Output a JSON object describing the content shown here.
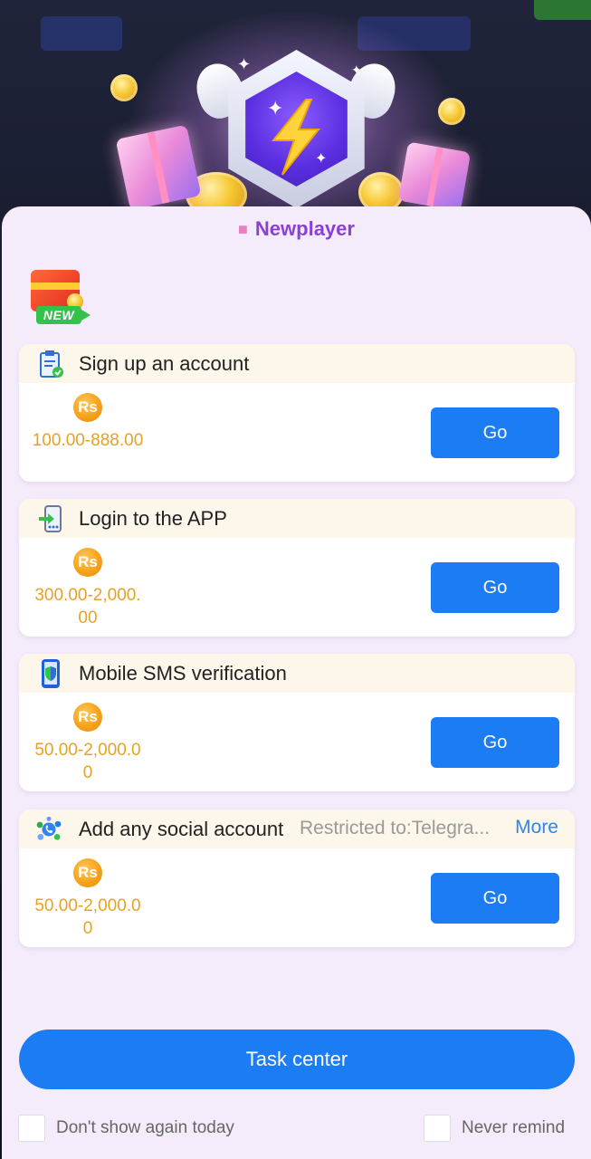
{
  "modal": {
    "title": "Newplayer",
    "new_badge_label": "NEW"
  },
  "tasks": [
    {
      "title": "Sign up an account",
      "icon": "clipboard-check-icon",
      "currency": "Rs",
      "reward": "100.00-888.00",
      "button": "Go"
    },
    {
      "title": "Login to the APP",
      "icon": "phone-login-icon",
      "currency": "Rs",
      "reward": "300.00-2,000.00",
      "button": "Go"
    },
    {
      "title": "Mobile SMS verification",
      "icon": "phone-shield-icon",
      "currency": "Rs",
      "reward": "50.00-2,000.00",
      "button": "Go"
    },
    {
      "title": "Add any social account",
      "icon": "social-network-icon",
      "restriction": "Restricted to:Telegra...",
      "more": "More",
      "currency": "Rs",
      "reward": "50.00-2,000.00",
      "button": "Go"
    }
  ],
  "footer": {
    "task_center": "Task center",
    "dont_show_today": "Don't show again today",
    "never_remind": "Never remind"
  },
  "colors": {
    "accent_blue": "#1b7cf3",
    "title_purple": "#8b3fd6",
    "reward_gold": "#e7a223",
    "modal_bg": "#f4ecfb"
  }
}
